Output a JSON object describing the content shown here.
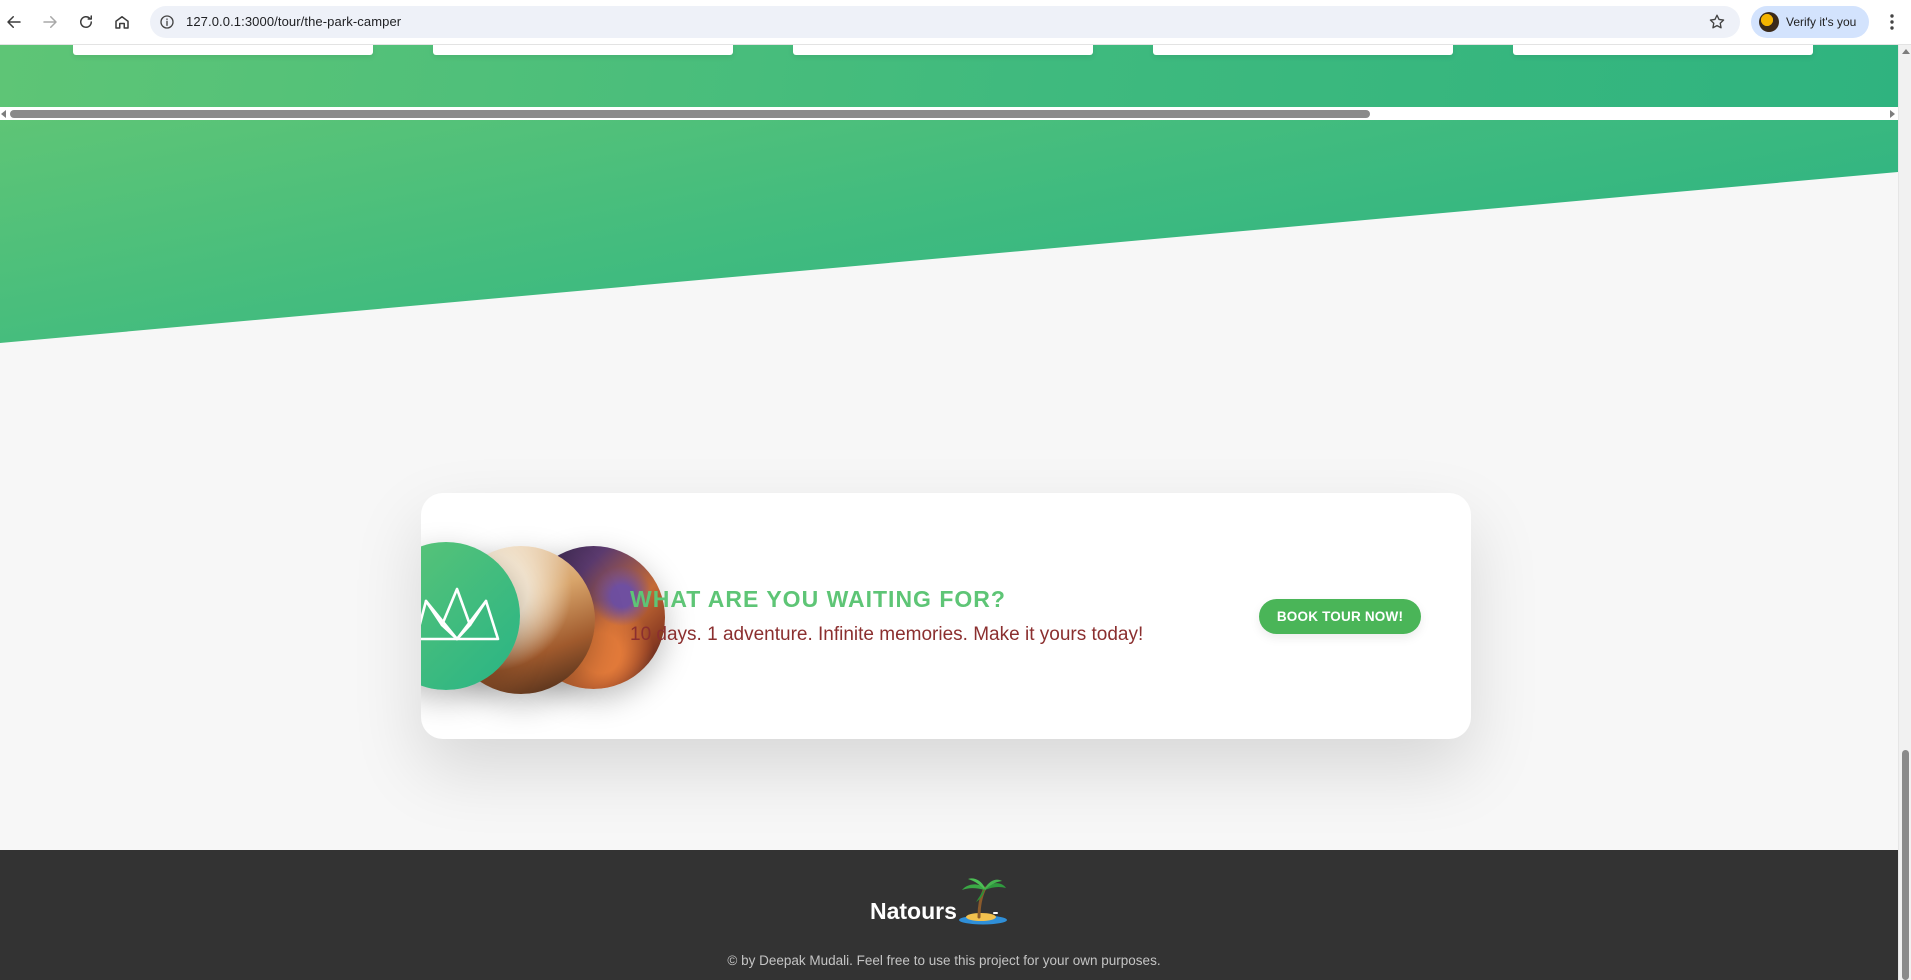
{
  "browser": {
    "url": "127.0.0.1:3000/tour/the-park-camper",
    "verify_label": "Verify it's you"
  },
  "cta": {
    "heading": "What are you waiting for?",
    "subtext": "10 days. 1 adventure. Infinite memories. Make it yours today!",
    "button_label": "Book tour now!"
  },
  "footer": {
    "logo_text": "Natours",
    "copyright": "© by Deepak Mudali. Feel free to use this project for your own purposes."
  },
  "icons": {
    "back": "arrow-left-icon",
    "forward": "arrow-right-icon",
    "reload": "reload-icon",
    "home": "home-icon",
    "site_info": "info-icon",
    "bookmark": "star-icon",
    "menu": "kebab-icon",
    "logo": "crown-logo-icon",
    "palm": "palm-island-icon"
  },
  "colors": {
    "brand_green": "#5ec576",
    "brand_green_dark": "#28b485",
    "button_green": "#4ab558",
    "subtext_red": "#8b2f2f",
    "footer_bg": "#333333"
  }
}
